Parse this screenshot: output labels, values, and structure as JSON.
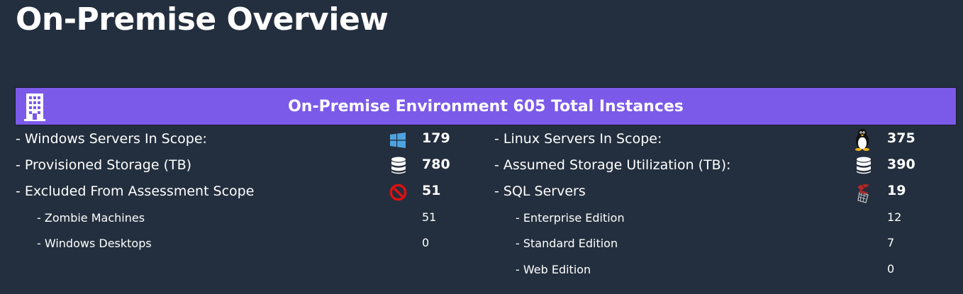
{
  "page": {
    "title": "On-Premise Overview"
  },
  "banner": {
    "icon": "building-icon",
    "text": "On-Premise Environment 605 Total Instances"
  },
  "left": {
    "rows": [
      {
        "label": "- Windows Servers In Scope:",
        "icon": "windows-icon",
        "value": "179"
      },
      {
        "label": "- Provisioned Storage (TB)",
        "icon": "database-icon",
        "value": "780"
      },
      {
        "label": "- Excluded From Assessment Scope",
        "icon": "prohibited-icon",
        "value": "51"
      }
    ],
    "subrows": [
      {
        "label": "- Zombie Machines",
        "value": "51"
      },
      {
        "label": "- Windows Desktops",
        "value": "0"
      }
    ]
  },
  "right": {
    "rows": [
      {
        "label": "- Linux Servers In Scope:",
        "icon": "linux-penguin-icon",
        "value": "375"
      },
      {
        "label": "- Assumed Storage Utilization (TB):",
        "icon": "database-icon",
        "value": "390"
      },
      {
        "label": "- SQL Servers",
        "icon": "sql-server-icon",
        "value": "19"
      }
    ],
    "subrows": [
      {
        "label": "- Enterprise Edition",
        "value": "12"
      },
      {
        "label": "- Standard Edition",
        "value": "7"
      },
      {
        "label": "- Web Edition",
        "value": "0"
      }
    ]
  },
  "colors": {
    "background": "#232f3e",
    "banner": "#7b5ae9",
    "windows_blue": "#4fa3e0",
    "prohibited_red": "#e01010"
  }
}
